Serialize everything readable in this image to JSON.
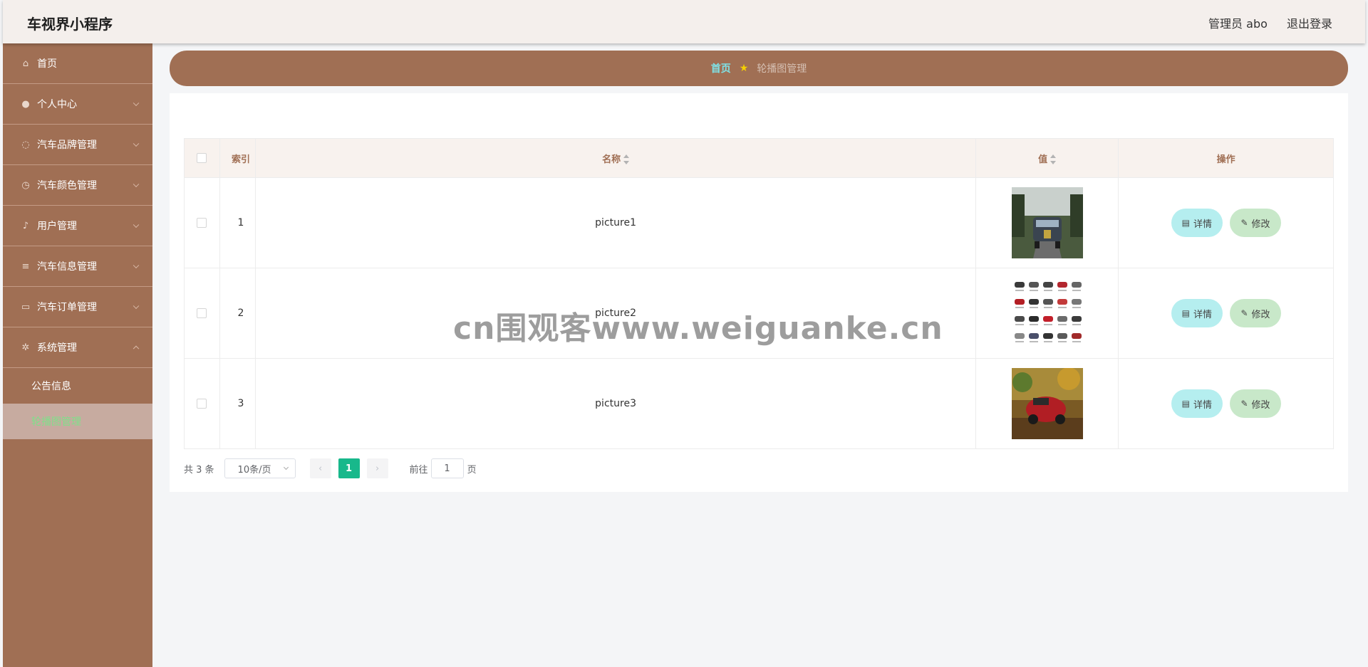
{
  "header": {
    "app_title": "车视界小程序",
    "user_label": "管理员 abo",
    "logout_label": "退出登录"
  },
  "sidebar": {
    "items": [
      {
        "label": "首页",
        "icon": "home-icon",
        "glyph": "⌂",
        "has_children": false
      },
      {
        "label": "个人中心",
        "icon": "user-icon",
        "glyph": "●",
        "has_children": true
      },
      {
        "label": "汽车品牌管理",
        "icon": "power-icon",
        "glyph": "◌",
        "has_children": true
      },
      {
        "label": "汽车颜色管理",
        "icon": "clock-icon",
        "glyph": "◷",
        "has_children": true
      },
      {
        "label": "用户管理",
        "icon": "mic-icon",
        "glyph": "♪",
        "has_children": true
      },
      {
        "label": "汽车信息管理",
        "icon": "sliders-icon",
        "glyph": "≡",
        "has_children": true
      },
      {
        "label": "汽车订单管理",
        "icon": "monitor-icon",
        "glyph": "▭",
        "has_children": true
      },
      {
        "label": "系统管理",
        "icon": "settings-icon",
        "glyph": "✲",
        "has_children": true,
        "expanded": true
      }
    ],
    "sub_items": [
      {
        "label": "公告信息",
        "active": false
      },
      {
        "label": "轮播图管理",
        "active": true
      }
    ]
  },
  "breadcrumb": {
    "home": "首页",
    "current": "轮播图管理"
  },
  "table": {
    "headers": {
      "index": "索引",
      "name": "名称",
      "value": "值",
      "actions": "操作"
    },
    "rows": [
      {
        "index": "1",
        "name": "picture1",
        "image": "car-front-road"
      },
      {
        "index": "2",
        "name": "picture2",
        "image": "car-color-grid"
      },
      {
        "index": "3",
        "name": "picture3",
        "image": "red-car-autumn"
      }
    ],
    "detail_label": "详情",
    "edit_label": "修改"
  },
  "pagination": {
    "total_text": "共 3 条",
    "page_size": "10条/页",
    "current_page": "1",
    "goto_label": "前往",
    "goto_value": "1",
    "page_unit": "页"
  },
  "watermark": "cn围观客www.weiguanke.cn",
  "colors": {
    "sidebar": "#a06f54",
    "header": "#f4efec",
    "detail_button": "#b5eeef",
    "edit_button": "#c8e8c9",
    "active_page": "#18b88b",
    "active_sub_text": "#7fe08a"
  }
}
